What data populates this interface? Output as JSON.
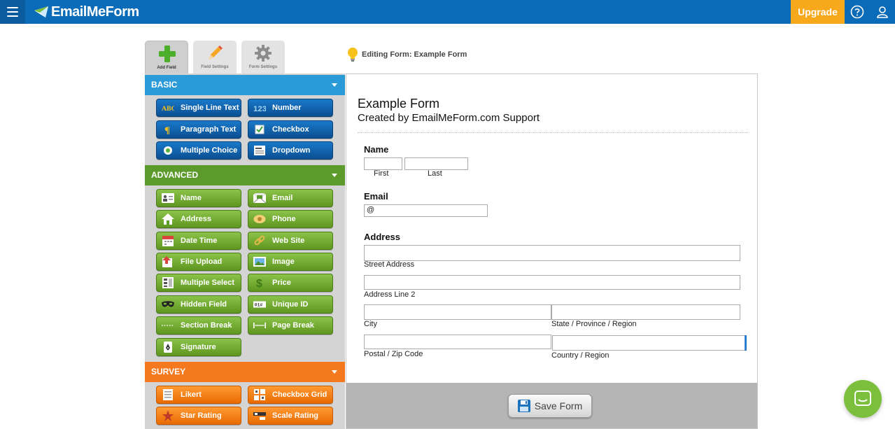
{
  "header": {
    "logo_text": "EmailMeForm",
    "upgrade_label": "Upgrade",
    "brand_color": "#0a6bb8",
    "upgrade_color": "#f7a81b"
  },
  "tabs": [
    {
      "label": "Add Field",
      "icon": "add-plus-icon",
      "active": true
    },
    {
      "label": "Field Settings",
      "icon": "pencil-icon",
      "active": false
    },
    {
      "label": "Form Settings",
      "icon": "gear-icon",
      "active": false
    }
  ],
  "editing": {
    "text": "Editing Form: Example Form",
    "icon": "lightbulb-icon"
  },
  "sidebar": {
    "basic": {
      "title": "BASIC",
      "color": "#2b9ad9",
      "buttons": [
        {
          "label": "Single Line Text",
          "icon": "abc-icon"
        },
        {
          "label": "Number",
          "icon": "123-icon"
        },
        {
          "label": "Paragraph Text",
          "icon": "pilcrow-icon"
        },
        {
          "label": "Checkbox",
          "icon": "checkbox-icon"
        },
        {
          "label": "Multiple Choice",
          "icon": "radio-icon"
        },
        {
          "label": "Dropdown",
          "icon": "dropdown-icon"
        }
      ]
    },
    "advanced": {
      "title": "ADVANCED",
      "color": "#5d9a2c",
      "buttons": [
        {
          "label": "Name",
          "icon": "id-card-icon"
        },
        {
          "label": "Email",
          "icon": "envelope-icon"
        },
        {
          "label": "Address",
          "icon": "house-icon"
        },
        {
          "label": "Phone",
          "icon": "phone-icon"
        },
        {
          "label": "Date Time",
          "icon": "calendar-icon"
        },
        {
          "label": "Web Site",
          "icon": "link-icon"
        },
        {
          "label": "File Upload",
          "icon": "upload-icon"
        },
        {
          "label": "Image",
          "icon": "image-icon"
        },
        {
          "label": "Multiple Select",
          "icon": "multi-select-icon"
        },
        {
          "label": "Price",
          "icon": "dollar-icon"
        },
        {
          "label": "Hidden Field",
          "icon": "mask-icon"
        },
        {
          "label": "Unique ID",
          "icon": "unique-id-icon"
        },
        {
          "label": "Section Break",
          "icon": "section-break-icon"
        },
        {
          "label": "Page Break",
          "icon": "page-break-icon"
        },
        {
          "label": "Signature",
          "icon": "signature-pen-icon"
        }
      ]
    },
    "survey": {
      "title": "SURVEY",
      "color": "#f57a1f",
      "buttons": [
        {
          "label": "Likert",
          "icon": "likert-icon"
        },
        {
          "label": "Checkbox Grid",
          "icon": "checkbox-grid-icon"
        },
        {
          "label": "Star Rating",
          "icon": "star-icon"
        },
        {
          "label": "Scale Rating",
          "icon": "scale-rating-icon"
        }
      ]
    }
  },
  "form": {
    "title": "Example Form",
    "subtitle": "Created by EmailMeForm.com Support",
    "name": {
      "label": "Name",
      "first": "First",
      "last": "Last"
    },
    "email": {
      "label": "Email",
      "value": "@"
    },
    "address": {
      "label": "Address",
      "street": "Street Address",
      "line2": "Address Line 2",
      "city": "City",
      "state": "State / Province / Region",
      "postal": "Postal / Zip Code",
      "country": "Country / Region"
    },
    "save_label": "Save Form"
  }
}
